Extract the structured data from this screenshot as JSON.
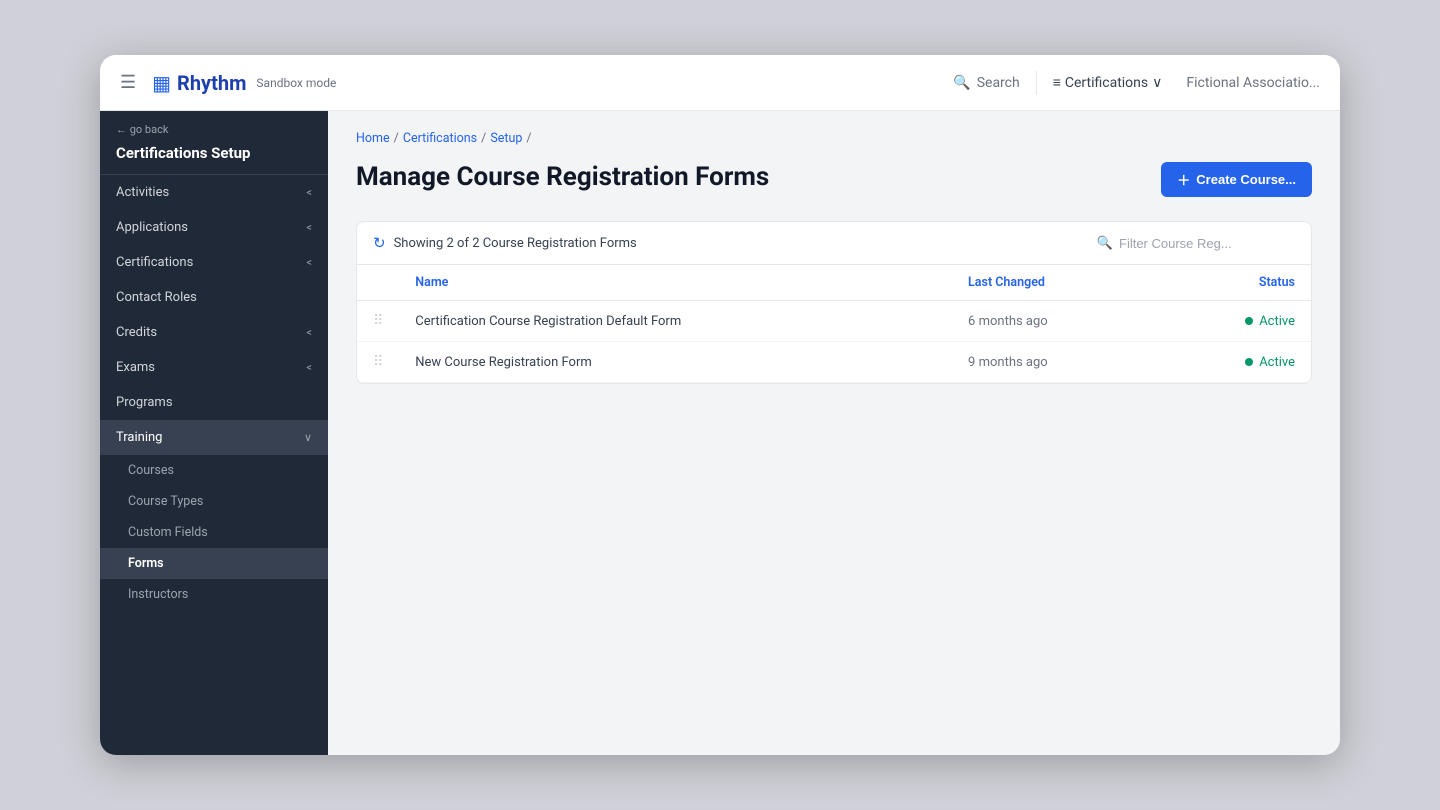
{
  "topnav": {
    "hamburger_label": "☰",
    "logo_icon": "▦",
    "logo_text": "Rhythm",
    "sandbox_label": "Sandbox mode",
    "search_label": "Search",
    "certifications_label": "Certifications",
    "certifications_chevron": "∨",
    "org_label": "Fictional Associatio..."
  },
  "sidebar": {
    "back_label": "← go back",
    "title": "Certifications Setup",
    "items": [
      {
        "id": "activities",
        "label": "Activities",
        "has_chevron": true,
        "chevron": "<"
      },
      {
        "id": "applications",
        "label": "Applications",
        "has_chevron": true,
        "chevron": "<"
      },
      {
        "id": "certifications",
        "label": "Certifications",
        "has_chevron": true,
        "chevron": "<"
      },
      {
        "id": "contact-roles",
        "label": "Contact Roles",
        "has_chevron": false
      },
      {
        "id": "credits",
        "label": "Credits",
        "has_chevron": true,
        "chevron": "<"
      },
      {
        "id": "exams",
        "label": "Exams",
        "has_chevron": true,
        "chevron": "<"
      },
      {
        "id": "programs",
        "label": "Programs",
        "has_chevron": false
      },
      {
        "id": "training",
        "label": "Training",
        "has_chevron": true,
        "chevron": "∨",
        "active": true
      }
    ],
    "sub_items": [
      {
        "id": "courses",
        "label": "Courses"
      },
      {
        "id": "course-types",
        "label": "Course Types"
      },
      {
        "id": "custom-fields",
        "label": "Custom Fields"
      },
      {
        "id": "forms",
        "label": "Forms",
        "active": true
      },
      {
        "id": "instructors",
        "label": "Instructors"
      }
    ]
  },
  "breadcrumb": {
    "items": [
      "Home",
      "Certifications",
      "Setup"
    ]
  },
  "page": {
    "title": "Manage Course Registration Forms",
    "create_button": "+ Create Cour..."
  },
  "table": {
    "count_text": "Showing 2 of 2 Course Registration Forms",
    "filter_placeholder": "Filter Course Reg...",
    "columns": [
      {
        "id": "drag",
        "label": ""
      },
      {
        "id": "name",
        "label": "Name"
      },
      {
        "id": "last_changed",
        "label": "Last Changed"
      },
      {
        "id": "status",
        "label": "Status"
      }
    ],
    "rows": [
      {
        "id": 1,
        "name": "Certification Course Registration Default Form",
        "last_changed": "6 months ago",
        "status": "Active"
      },
      {
        "id": 2,
        "name": "New Course Registration Form",
        "last_changed": "9 months ago",
        "status": "Active"
      }
    ]
  }
}
